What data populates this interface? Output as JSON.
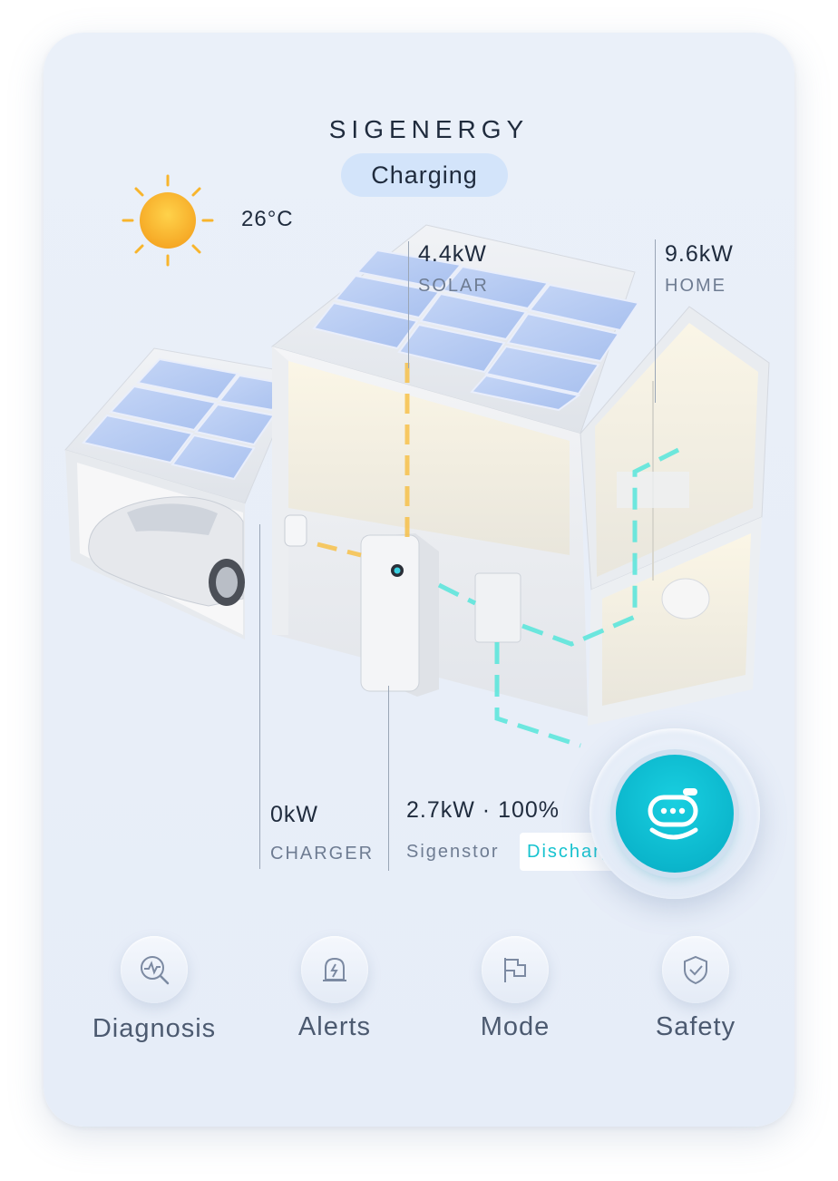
{
  "brand": {
    "logo_text": "SIGENERGY"
  },
  "status": {
    "label": "Charging"
  },
  "weather": {
    "icon": "sun-icon",
    "temperature": "26°C"
  },
  "flows": {
    "solar": {
      "value": "4.4kW",
      "label": "SOLAR"
    },
    "home": {
      "value": "9.6kW",
      "label": "HOME"
    },
    "charger": {
      "value": "0kW",
      "label": "CHARGER"
    },
    "battery": {
      "value": "2.7kW · 100%",
      "label": "Sigenstor",
      "state": "Discharging"
    }
  },
  "assistant": {
    "icon": "robot-face-icon"
  },
  "actions": [
    {
      "label": "Diagnosis",
      "icon": "diagnosis-icon"
    },
    {
      "label": "Alerts",
      "icon": "alert-bell-icon"
    },
    {
      "label": "Mode",
      "icon": "mode-flag-icon"
    },
    {
      "label": "Safety",
      "icon": "shield-check-icon"
    }
  ],
  "colors": {
    "accent": "#15c3cf",
    "solar_flow": "#f7c14a",
    "grid_flow": "#5ee6dc",
    "text": "#1f2b3d",
    "muted": "#6e7c92"
  }
}
